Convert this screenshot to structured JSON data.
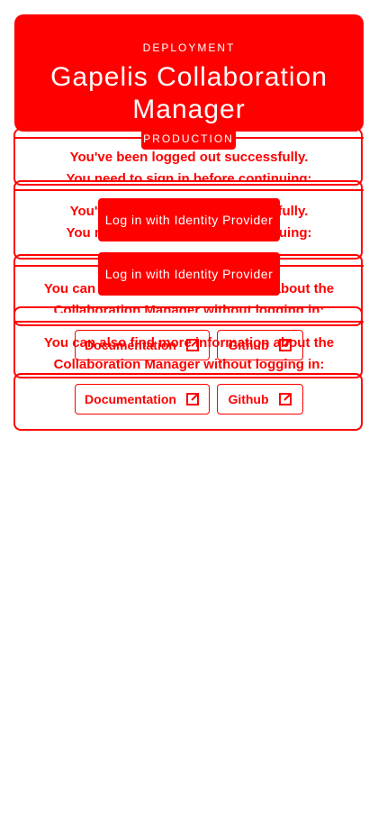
{
  "app": {
    "subtitle": "DEPLOYMENT",
    "title": "Gapelis Collaboration Manager",
    "badge": "PRODUCTION"
  },
  "messages": {
    "logged_out": "You've been logged out successfully.",
    "need_sign_in": "You need to sign in before continuing:",
    "need_sign_in_partial": "You ne",
    "need_sign_in_tail": "uing:",
    "logged_out_partial": "You'",
    "logged_out_tail": "fully.",
    "more_info_1": "You can also find more information about the",
    "more_info_2": "Collaboration Manager without logging in:",
    "more_info_partial": "You can",
    "more_info_tail": "bout the"
  },
  "buttons": {
    "login_label": "Log in with Identity Provider",
    "documentation_label": "Documentation",
    "github_label": "Github"
  },
  "icons": {
    "external_link": "external-link-icon"
  },
  "colors": {
    "accent": "#ff0000",
    "background": "#ffffff",
    "on_accent": "#ffffff"
  }
}
